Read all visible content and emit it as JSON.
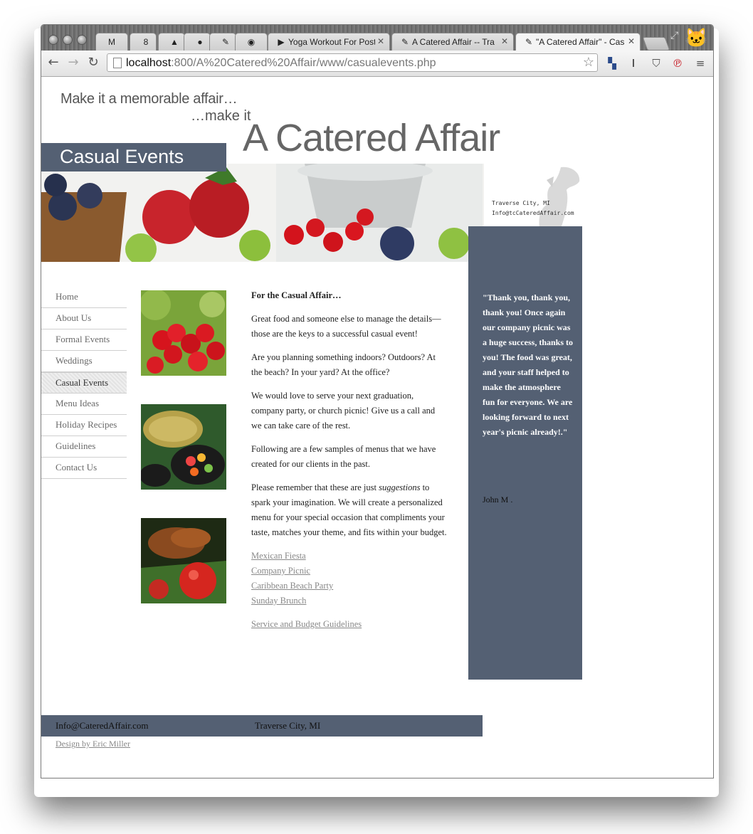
{
  "browser": {
    "tabs": [
      {
        "icon": "gmail-icon",
        "glyph": "M",
        "label": ""
      },
      {
        "icon": "calendar-icon",
        "glyph": "8",
        "label": ""
      },
      {
        "icon": "drive-icon",
        "glyph": "▲",
        "label": ""
      },
      {
        "icon": "orange-app-icon",
        "glyph": "●",
        "label": ""
      },
      {
        "icon": "pin-icon",
        "glyph": "✎",
        "label": ""
      },
      {
        "icon": "github-icon",
        "glyph": "◉",
        "label": ""
      },
      {
        "icon": "youtube-icon",
        "glyph": "▶",
        "label": "Yoga Workout For Post"
      },
      {
        "icon": "pin-icon",
        "glyph": "✎",
        "label": "A Catered Affair -- Tra"
      },
      {
        "icon": "pin-icon",
        "glyph": "✎",
        "label": "\"A Catered Affair\" - Cas"
      }
    ],
    "url_host": "localhost",
    "url_rest": ":800/A%20Catered%20Affair/www/casualevents.php",
    "nav": {
      "back": "←",
      "forward": "→",
      "reload": "↻"
    },
    "extensions": [
      {
        "name": "delicious-icon",
        "glyph": "▚"
      },
      {
        "name": "instapaper-icon",
        "glyph": "I"
      },
      {
        "name": "pocket-icon",
        "glyph": "⛉"
      },
      {
        "name": "pinterest-icon",
        "glyph": "℗"
      },
      {
        "name": "menu-icon",
        "glyph": "≡"
      }
    ]
  },
  "site": {
    "tagline1": "Make it a memorable affair…",
    "tagline2": "…make it",
    "logo": "A Catered Affair",
    "section_title": "Casual Events",
    "contact_city": "Traverse City, MI",
    "contact_email": "Info@tcCateredAffair.com",
    "nav": [
      {
        "label": "Home",
        "active": false
      },
      {
        "label": "About Us",
        "active": false
      },
      {
        "label": "Formal Events",
        "active": false
      },
      {
        "label": "Weddings",
        "active": false
      },
      {
        "label": "Casual Events",
        "active": true
      },
      {
        "label": "Menu Ideas",
        "active": false
      },
      {
        "label": "Holiday Recipes",
        "active": false
      },
      {
        "label": "Guidelines",
        "active": false
      },
      {
        "label": "Contact Us",
        "active": false
      }
    ],
    "content": {
      "heading": "For the Casual Affair…",
      "p1": "Great food and someone else to manage the details—those are the keys to a successful casual event!",
      "p2": "Are you planning something indoors? Outdoors? At the beach? In your yard? At the office?",
      "p3": "We would love to serve your next graduation, company party, or church picnic! Give us a call and we can take care of the rest.",
      "p4": "Following are a few samples of menus that we have created for our clients in the past.",
      "p5_before": "Please remember that these are just ",
      "p5_em": "suggestions",
      "p5_after": " to spark your imagination. We will create a personalized menu for your special occasion that compliments your taste, matches your theme, and fits within your budget.",
      "links": [
        "Mexican Fiesta",
        "Company Picnic",
        "Caribbean Beach Party",
        "Sunday Brunch"
      ],
      "guidelines_link": "Service and Budget Guidelines"
    },
    "quote": "\"Thank you, thank you, thank you! Once again our company picnic was a huge success, thanks to you! The food was great, and your staff helped to make the atmosphere fun for everyone. We are looking forward to next year's picnic already!.\"",
    "quote_author": "John M .",
    "footer_email": "Info@CateredAffair.com",
    "footer_city": "Traverse City, MI",
    "credit": "Design by Eric Miller"
  }
}
